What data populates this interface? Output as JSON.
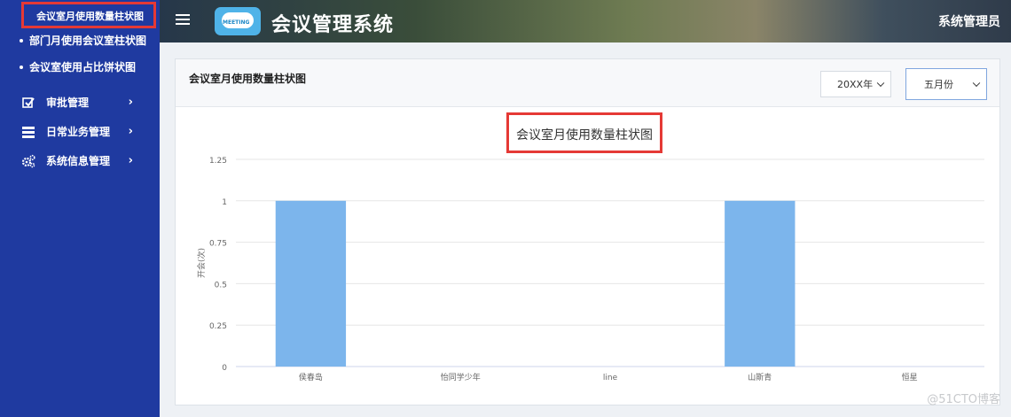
{
  "sidebar": {
    "sub_items": [
      {
        "label": "会议室月使用数量柱状图"
      },
      {
        "label": "部门月使用会议室柱状图"
      },
      {
        "label": "会议室使用占比饼状图"
      }
    ],
    "menu": [
      {
        "label": "审批管理",
        "icon": "check-square-icon"
      },
      {
        "label": "日常业务管理",
        "icon": "list-icon"
      },
      {
        "label": "系统信息管理",
        "icon": "gears-icon"
      }
    ]
  },
  "header": {
    "logo_text": "MEETING",
    "app_title": "会议管理系统",
    "user": "系统管理员"
  },
  "card": {
    "title": "会议室月使用数量柱状图",
    "year_select": "20XX年",
    "month_select": "五月份"
  },
  "chart_data": {
    "type": "bar",
    "title": "会议室月使用数量柱状图",
    "ylabel": "开会(次)",
    "xlabel": "",
    "categories": [
      "侯春岛",
      "怡同学少年",
      "line",
      "山斯青",
      "恒星"
    ],
    "values": [
      1,
      0,
      0,
      1,
      0
    ],
    "ylim": [
      0,
      1.25
    ],
    "yticks": [
      "0",
      "0.25",
      "0.5",
      "0.75",
      "1",
      "1.25"
    ],
    "grid": true,
    "bar_color": "#7cb5ec"
  },
  "watermark": "@51CTO博客"
}
